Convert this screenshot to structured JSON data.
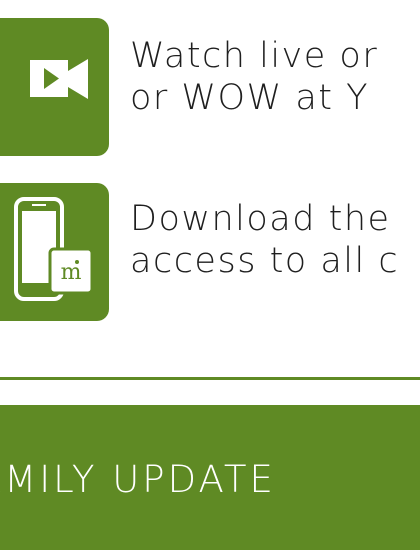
{
  "rows": [
    {
      "icon": "video-camera-icon",
      "line1": "Watch live or",
      "line2": "or WOW at Y"
    },
    {
      "icon": "mobile-app-icon",
      "line1": "Download the",
      "line2": "access to all c"
    }
  ],
  "banner": {
    "text": "AMILY UPDATE"
  },
  "colors": {
    "brand_green": "#5f8a24",
    "text_dark": "#1f1f1f",
    "white": "#ffffff"
  }
}
